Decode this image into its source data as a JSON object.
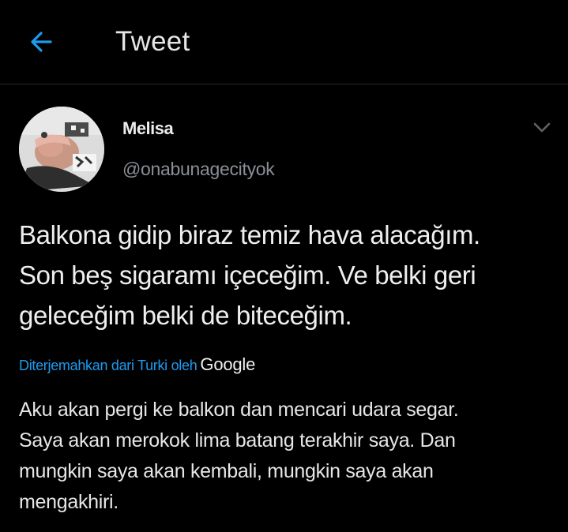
{
  "header": {
    "title": "Tweet",
    "back_icon": "arrow-left-icon",
    "accent_color": "#1d9bf0"
  },
  "tweet": {
    "author": {
      "display_name": "Melisa",
      "handle": "@onabunagecityok",
      "avatar_icon": "user-avatar"
    },
    "menu_icon": "chevron-down-icon",
    "text_lines": [
      "Balkona gidip biraz temiz hava alacağım.",
      "Son beş sigaramı içeceğim. Ve belki geri",
      "geleceğim belki de biteceğim."
    ],
    "translation": {
      "label": "Diterjemahkan dari Turki oleh",
      "provider": "Google",
      "text_lines": [
        "Aku akan pergi ke balkon dan mencari udara segar.",
        "Saya akan merokok lima batang terakhir saya. Dan",
        "mungkin saya akan kembali, mungkin saya akan",
        "mengakhiri."
      ]
    }
  }
}
